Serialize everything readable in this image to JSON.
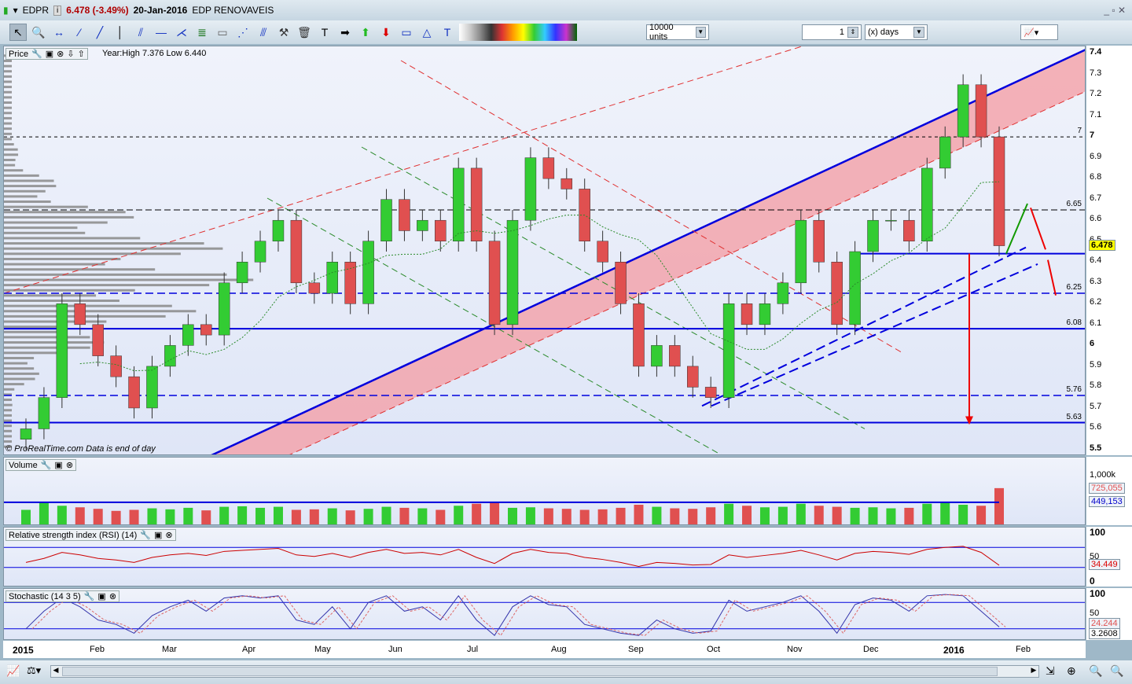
{
  "header": {
    "symbol": "EDPR",
    "price_change": "6.478 (-3.49%)",
    "date": "20-Jan-2016",
    "name": "EDP RENOVAVEIS"
  },
  "toolbar": {
    "units": "10000 units",
    "period_value": "1",
    "period_unit": "(x) days"
  },
  "price_panel": {
    "label": "Price",
    "year_info": "Year:High 7.376 Low 6.440",
    "watermark": "© ProRealTime.com  Data is end of day",
    "ticks": [
      "7.4",
      "7.3",
      "7.2",
      "7.1",
      "7",
      "6.9",
      "6.8",
      "6.7",
      "6.6",
      "6.5",
      "6.4",
      "6.3",
      "6.2",
      "6.1",
      "6",
      "5.9",
      "5.8",
      "5.7",
      "5.6",
      "5.5"
    ],
    "level_labels": [
      "7",
      "6.65",
      "6.25",
      "6.08",
      "5.76",
      "5.63"
    ],
    "last_price": "6.478"
  },
  "volume_panel": {
    "label": "Volume",
    "ticks": [
      "1,000k"
    ],
    "last_volume": "725,055",
    "average": "449,153"
  },
  "rsi_panel": {
    "label": "Relative strength index (RSI) (14)",
    "ticks": [
      "100",
      "50",
      "0"
    ],
    "value": "34.449"
  },
  "stoch_panel": {
    "label": "Stochastic (14 3 5)",
    "ticks": [
      "100",
      "50"
    ],
    "k": "24.244",
    "d": "3.2608"
  },
  "date_axis": [
    "2015",
    "Feb",
    "Mar",
    "Apr",
    "May",
    "Jun",
    "Jul",
    "Aug",
    "Sep",
    "Oct",
    "Nov",
    "Dec",
    "2016",
    "Feb"
  ],
  "colors": {
    "up": "#33cc33",
    "down": "#e05050",
    "trend": "#0000dd",
    "band": "#f4a0a8"
  },
  "chart_data": {
    "type": "candlestick",
    "xlabel": "",
    "ylabel": "Price",
    "ylim": [
      5.5,
      7.4
    ],
    "weekly_closes": [
      5.6,
      5.75,
      6.2,
      6.1,
      5.95,
      5.85,
      5.7,
      5.9,
      6.0,
      6.1,
      6.05,
      6.3,
      6.4,
      6.5,
      6.6,
      6.3,
      6.25,
      6.4,
      6.2,
      6.5,
      6.7,
      6.55,
      6.6,
      6.5,
      6.85,
      6.5,
      6.1,
      6.6,
      6.9,
      6.8,
      6.75,
      6.5,
      6.4,
      6.2,
      5.9,
      6.0,
      5.9,
      5.8,
      5.75,
      6.2,
      6.1,
      6.2,
      6.3,
      6.6,
      6.4,
      6.1,
      6.45,
      6.6,
      6.6,
      6.5,
      6.85,
      7.0,
      7.25,
      7.0,
      6.478
    ],
    "weekly_volume_k": [
      300,
      450,
      380,
      350,
      320,
      280,
      300,
      330,
      310,
      340,
      290,
      360,
      370,
      340,
      360,
      300,
      310,
      330,
      290,
      320,
      360,
      340,
      330,
      300,
      380,
      420,
      450,
      340,
      350,
      330,
      320,
      300,
      310,
      340,
      400,
      360,
      330,
      320,
      350,
      420,
      380,
      350,
      360,
      420,
      380,
      360,
      340,
      350,
      330,
      340,
      420,
      460,
      400,
      380,
      725
    ],
    "rsi": [
      40,
      48,
      60,
      55,
      48,
      45,
      40,
      50,
      55,
      58,
      54,
      62,
      64,
      66,
      68,
      55,
      52,
      58,
      50,
      60,
      66,
      58,
      60,
      55,
      66,
      50,
      38,
      58,
      66,
      60,
      58,
      50,
      46,
      40,
      32,
      40,
      38,
      35,
      36,
      55,
      50,
      54,
      58,
      64,
      55,
      45,
      58,
      62,
      60,
      56,
      66,
      70,
      72,
      60,
      34.449
    ],
    "stochastic": [
      20,
      60,
      90,
      70,
      40,
      30,
      10,
      50,
      70,
      85,
      60,
      90,
      95,
      90,
      95,
      40,
      30,
      70,
      20,
      80,
      95,
      60,
      70,
      40,
      95,
      40,
      5,
      70,
      95,
      75,
      70,
      30,
      20,
      10,
      5,
      40,
      20,
      10,
      15,
      85,
      60,
      70,
      80,
      95,
      60,
      10,
      75,
      90,
      85,
      60,
      95,
      98,
      95,
      60,
      24.244
    ]
  }
}
